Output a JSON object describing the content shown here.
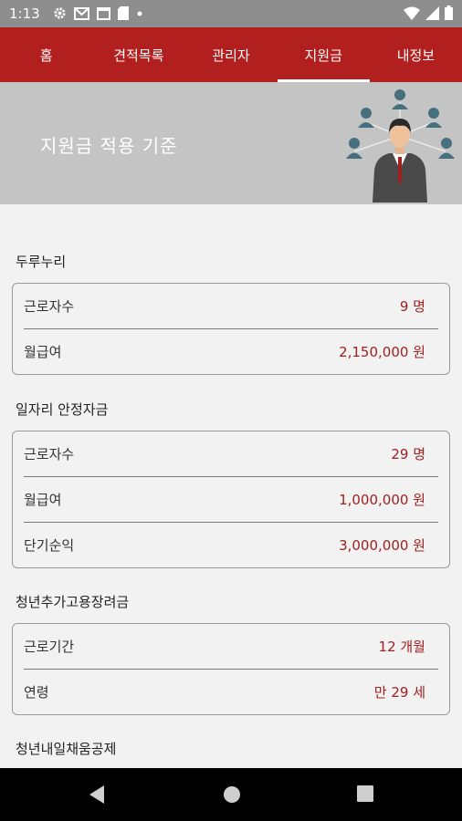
{
  "status": {
    "time": "1:13"
  },
  "nav": {
    "tabs": [
      "홈",
      "견적목록",
      "관리자",
      "지원금",
      "내정보"
    ]
  },
  "banner": {
    "title": "지원금 적용 기준"
  },
  "sections": [
    {
      "title": "두루누리",
      "rows": [
        {
          "label": "근로자수",
          "value": "9 명"
        },
        {
          "label": "월급여",
          "value": "2,150,000 원"
        }
      ]
    },
    {
      "title": "일자리 안정자금",
      "rows": [
        {
          "label": "근로자수",
          "value": "29 명"
        },
        {
          "label": "월급여",
          "value": "1,000,000 원"
        },
        {
          "label": "단기순익",
          "value": "3,000,000 원"
        }
      ]
    },
    {
      "title": "청년추가고용장려금",
      "rows": [
        {
          "label": "근로기간",
          "value": "12 개월"
        },
        {
          "label": "연령",
          "value": "만 29 세"
        }
      ]
    },
    {
      "title": "청년내일채움공제"
    }
  ],
  "colors": {
    "primary": "#b21f1f",
    "value": "#a02020",
    "statusbar": "#8e8e8e"
  }
}
